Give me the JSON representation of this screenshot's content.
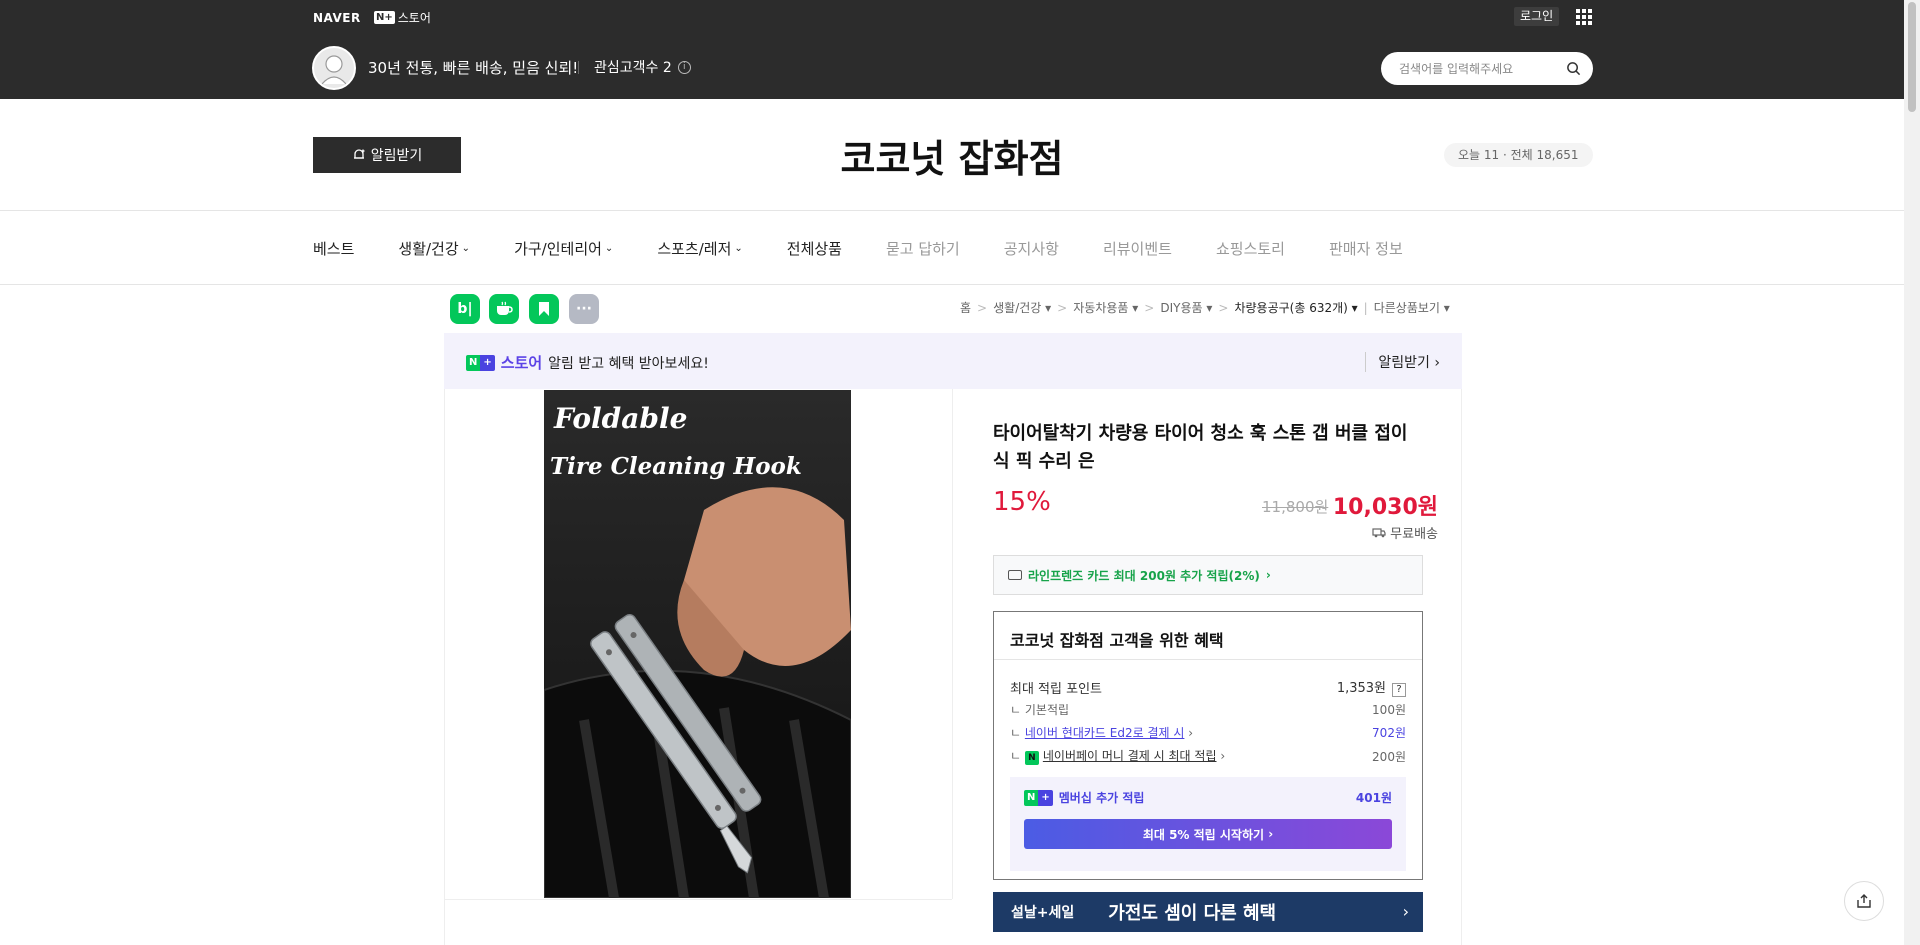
{
  "header": {
    "naver": "NAVER",
    "nplus": "N+",
    "store_label": "스토어",
    "login": "로그인",
    "slogan": "30년 전통, 빠른 배송, 믿음 신뢰!",
    "fans": "관심고객수 2",
    "search_placeholder": "검색어를 입력해주세요"
  },
  "store": {
    "notify_label": "알림받기",
    "title": "코코넛 잡화점",
    "visitors": "오늘 11 · 전체 18,651"
  },
  "nav": [
    {
      "label": "베스트",
      "chevron": false,
      "dim": false
    },
    {
      "label": "생활/건강",
      "chevron": true,
      "dim": false
    },
    {
      "label": "가구/인테리어",
      "chevron": true,
      "dim": false
    },
    {
      "label": "스포츠/레저",
      "chevron": true,
      "dim": false
    },
    {
      "label": "전체상품",
      "chevron": false,
      "dim": false
    },
    {
      "label": "묻고 답하기",
      "chevron": false,
      "dim": true
    },
    {
      "label": "공지사항",
      "chevron": false,
      "dim": true
    },
    {
      "label": "리뷰이벤트",
      "chevron": false,
      "dim": true
    },
    {
      "label": "쇼핑스토리",
      "chevron": false,
      "dim": true
    },
    {
      "label": "판매자 정보",
      "chevron": false,
      "dim": true
    }
  ],
  "share_icons": [
    "blog-icon",
    "talktalk-icon",
    "bookmark-icon",
    "more-icon"
  ],
  "breadcrumb": {
    "home": "홈",
    "c1": "생활/건강",
    "c2": "자동차용품",
    "c3": "DIY용품",
    "c4": "차량용공구(총 632개)",
    "other": "다른상품보기"
  },
  "promo": {
    "store_word": "스토어",
    "text": "알림 받고 혜택 받아보세요!",
    "right": "알림받기"
  },
  "product": {
    "image_text_1": "Foldable",
    "image_text_2": "Tire Cleaning Hook",
    "title": "타이어탈착기 차량용 타이어 청소 훅 스톤 갭 버클 접이식 픽 수리 은",
    "discount": "15%",
    "original_price": "11,800원",
    "sale_price": "10,030원",
    "shipping": "무료배송",
    "card_offer": "라인프렌즈 카드 최대 200원 추가 적립(2%)"
  },
  "benefits": {
    "title": "코코넛 잡화점 고객을 위한 혜택",
    "max_points_label": "최대 적립 포인트",
    "max_points_value": "1,353원",
    "help": "?",
    "rows": [
      {
        "label": "기본적립",
        "value": "100원"
      },
      {
        "label": "네이버 현대카드 Ed2로 결제 시",
        "value": "702원"
      },
      {
        "label": "네이버페이 머니 결제 시 최대 적립",
        "value": "200원"
      }
    ],
    "membership_label": "멤버십 추가 적립",
    "membership_value": "401원",
    "membership_button": "최대 5% 적립 시작하기"
  },
  "sale_banner": {
    "tag": "설날+세일",
    "text": "가전도 셈이 다른 혜택"
  },
  "colors": {
    "header_bg": "#2c2c2c",
    "accent_red": "#e0193b",
    "naver_green": "#03c75a",
    "nplus_purple": "#4a43e0"
  }
}
